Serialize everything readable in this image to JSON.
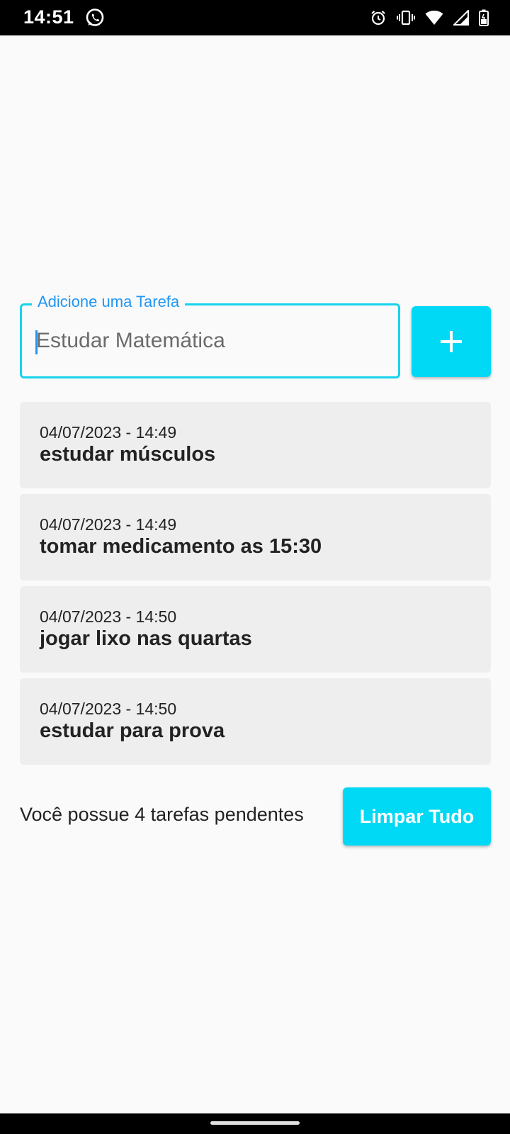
{
  "status_bar": {
    "time": "14:51",
    "icons": [
      "whatsapp-icon",
      "alarm-icon",
      "vibrate-icon",
      "wifi-icon",
      "signal-icon",
      "battery-icon"
    ]
  },
  "task_input": {
    "label": "Adicione uma Tarefa",
    "placeholder": "Estudar Matemática",
    "value": ""
  },
  "add_button": {
    "icon": "plus-icon"
  },
  "tasks": [
    {
      "date": "04/07/2023 - 14:49",
      "title": "estudar músculos"
    },
    {
      "date": "04/07/2023 - 14:49",
      "title": "tomar medicamento as 15:30"
    },
    {
      "date": "04/07/2023 - 14:50",
      "title": "jogar lixo nas quartas"
    },
    {
      "date": "04/07/2023 - 14:50",
      "title": "estudar para prova"
    }
  ],
  "footer": {
    "pending_text": "Você possue 4 tarefas pendentes",
    "clear_label": "Limpar Tudo"
  },
  "colors": {
    "accent": "#00d9f5",
    "input_border": "#16d3ec",
    "label": "#2196f3",
    "card": "#eeeeee",
    "background": "#fafafa"
  }
}
